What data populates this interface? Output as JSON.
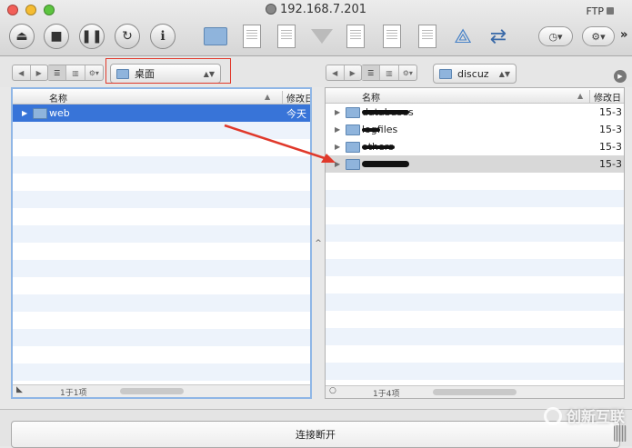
{
  "window": {
    "title": "192.168.7.201",
    "protocol": "FTP"
  },
  "toolbar": {
    "history_label": "◷▾",
    "action_label": "⚙▾",
    "more_label": "»"
  },
  "left_pane": {
    "location": "桌面",
    "columns": {
      "name": "名称",
      "modified": "修改日"
    },
    "rows": [
      {
        "name": "web",
        "modified": "今天"
      }
    ],
    "status": "1于1项"
  },
  "right_pane": {
    "location": "discuz",
    "columns": {
      "name": "名称",
      "modified": "修改日"
    },
    "rows": [
      {
        "name": "databases",
        "modified": "15-3"
      },
      {
        "name": "logfiles",
        "modified": "15-3"
      },
      {
        "name": "others",
        "modified": "15-3"
      },
      {
        "name": "",
        "modified": "15-3"
      }
    ],
    "status": "1于4项"
  },
  "bottom": {
    "disconnect_label": "连接断开"
  },
  "watermark": {
    "text": "创新互联"
  },
  "colors": {
    "selection": "#3874d8",
    "annotation_red": "#e0392b",
    "stripe": "#edf3fb"
  }
}
